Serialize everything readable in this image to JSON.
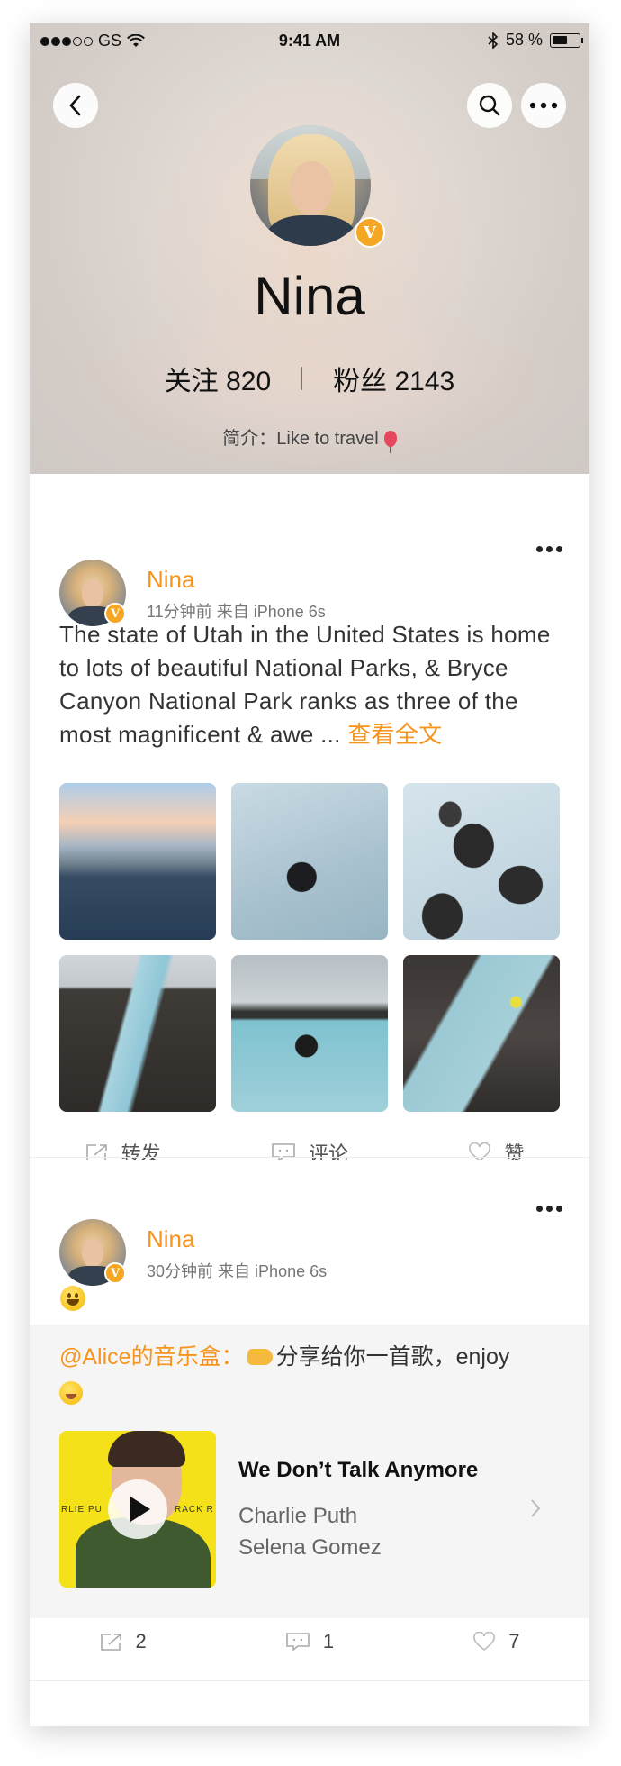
{
  "status_bar": {
    "carrier": "GS",
    "time": "9:41 AM",
    "battery": "58 %",
    "battery_level": 0.58
  },
  "profile": {
    "name": "Nina",
    "verified_badge": "V",
    "following_label": "关注",
    "following_count": "820",
    "followers_label": "粉丝",
    "followers_count": "2143",
    "bio_label": "简介：",
    "bio_text": "Like to travel",
    "bio_icon": "balloon-icon"
  },
  "posts": [
    {
      "author": "Nina",
      "time": "11分钟前",
      "source": "来自 iPhone 6s",
      "text": "The state of Utah in the United States is home to lots of beautiful National Parks, & Bryce Canyon National Park ranks as three of the most magnificent & awe ...",
      "read_more": "查看全文",
      "images": [
        "lake-shore-photo",
        "bather-in-blue-lagoon-photo",
        "lava-rocks-in-lagoon-photo",
        "lava-field-river-photo",
        "bathers-in-lagoon-photo",
        "person-on-rock-photo"
      ],
      "actions": {
        "repost": "转发",
        "comment": "评论",
        "like": "赞"
      }
    },
    {
      "author": "Nina",
      "time": "30分钟前",
      "source": "来自 iPhone 6s",
      "text_icon": "grinning-face-emoji",
      "repost": {
        "mention": "@Alice的音乐盒：",
        "text": "分享给你一首歌，enjoy",
        "song": {
          "title": "We Don’t Talk Anymore",
          "artist1": "Charlie Puth",
          "artist2": "Selena Gomez",
          "cover_text_left": "RLIE PU",
          "cover_text_right": "RACK R"
        }
      },
      "counts": {
        "repost": "2",
        "comment": "1",
        "like": "7"
      }
    }
  ],
  "colors": {
    "accent": "#f7941d",
    "badge": "#f5a623"
  }
}
